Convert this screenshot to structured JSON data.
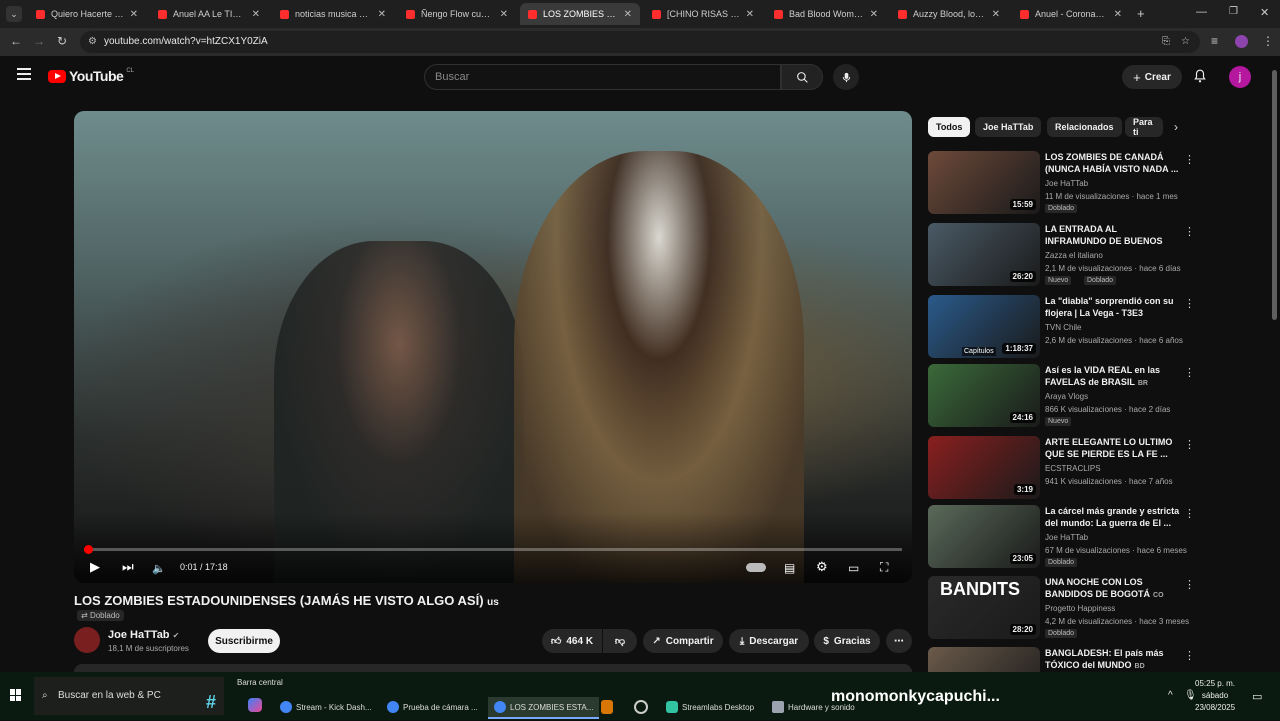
{
  "browser": {
    "tabs": [
      {
        "label": "Quiero Hacerte Cosit"
      },
      {
        "label": "Anuel AA Le TIRA a B"
      },
      {
        "label": "noticias musica urban"
      },
      {
        "label": "Ñengo Flow cuenta la"
      },
      {
        "label": "LOS ZOMBIES ESTAD",
        "active": true
      },
      {
        "label": "[CHINO RISAS DOCU"
      },
      {
        "label": "Bad Blood Womens F"
      },
      {
        "label": "Auzzy Blood, lo más"
      },
      {
        "label": "Anuel - Coronamos ("
      }
    ],
    "url": "youtube.com/watch?v=htZCX1Y0ZiA"
  },
  "header": {
    "logo": "YouTube",
    "logo_region": "CL",
    "search_placeholder": "Buscar",
    "create_label": "Crear",
    "avatar_letter": "j"
  },
  "player": {
    "current_time": "0:01",
    "duration": "17:18",
    "progress_fraction": 0.001
  },
  "video": {
    "title": "LOS ZOMBIES ESTADOUNIDENSES (JAMÁS HE VISTO ALGO ASÍ)",
    "title_suffix": "us",
    "badge": "Doblado",
    "channel": "Joe HaTTab",
    "subscribers": "18,1 M de suscriptores",
    "subscribe_label": "Suscribirme",
    "likes": "464 K",
    "share_label": "Compartir",
    "download_label": "Descargar",
    "thanks_label": "Gracias"
  },
  "sidebar": {
    "chips": [
      "Todos",
      "Joe HaTTab",
      "Relacionados",
      "Para ti"
    ],
    "recommendations": [
      {
        "title": "LOS ZOMBIES DE CANADÁ (NUNCA HABÍA VISTO NADA ...",
        "channel": "Joe HaTTab",
        "meta": "11 M de visualizaciones · hace 1 mes",
        "duration": "15:59",
        "badges": [
          "Doblado"
        ],
        "color": "#6d4a3a"
      },
      {
        "title": "LA ENTRADA AL INFRAMUNDO DE BUENOS AIRES - ¡Aquí NO ...",
        "channel": "Zazza el italiano",
        "meta": "2,1 M de visualizaciones · hace 6 días",
        "duration": "26:20",
        "badges": [
          "Nuevo",
          "Doblado"
        ],
        "color": "#4a5a66"
      },
      {
        "title": "La \"diabla\" sorprendió con su flojera | La Vega - T3E3",
        "channel": "TVN Chile",
        "meta": "2,6 M de visualizaciones · hace 6 años",
        "duration": "1:18:37",
        "badges": [],
        "color": "#2a5a8a",
        "overlay": "Capítulos"
      },
      {
        "title": "Así es la VIDA REAL en las FAVELAS de BRASIL",
        "title_suffix": "BR",
        "channel": "Araya Vlogs",
        "meta": "866 K visualizaciones · hace 2 días",
        "duration": "24:16",
        "badges": [
          "Nuevo"
        ],
        "color": "#3a6a3a"
      },
      {
        "title": "ARTE ELEGANTE   LO ULTIMO QUE SE PIERDE ES LA FE ...",
        "channel": "ECSTRACLIPS",
        "meta": "941 K visualizaciones · hace 7 años",
        "duration": "3:19",
        "badges": [],
        "color": "#8a1f1f"
      },
      {
        "title": "La cárcel más grande y estricta del mundo: La guerra de El ...",
        "channel": "Joe HaTTab",
        "meta": "67 M de visualizaciones · hace 6 meses",
        "duration": "23:05",
        "badges": [
          "Doblado"
        ],
        "color": "#5a6a5a"
      },
      {
        "title": "UNA NOCHE CON LOS BANDIDOS DE BOGOTÁ",
        "title_suffix": "CO",
        "channel": "Progetto Happiness",
        "meta": "4,2 M de visualizaciones · hace 3 meses",
        "duration": "28:20",
        "badges": [
          "Doblado"
        ],
        "color": "#2a2a2a",
        "overlay": "BANDITS"
      },
      {
        "title": "BANGLADESH: El país más TÓXICO del MUNDO",
        "title_suffix": "BD",
        "channel": "",
        "meta": "",
        "duration": "",
        "badges": [],
        "color": "#6a5a4a"
      }
    ]
  },
  "taskbar": {
    "search_placeholder": "Buscar en la web & PC",
    "widget_label": "Barra central",
    "items": [
      "Stream - Kick Dash...",
      "Prueba de cámara ...",
      "LOS ZOMBIES ESTA...",
      "Streamlabs Desktop",
      "Hardware y sonido"
    ],
    "overlay_text": "monomonkycapuchi...",
    "time": "05:25 p. m.",
    "day": "sábado",
    "date": "23/08/2025"
  }
}
